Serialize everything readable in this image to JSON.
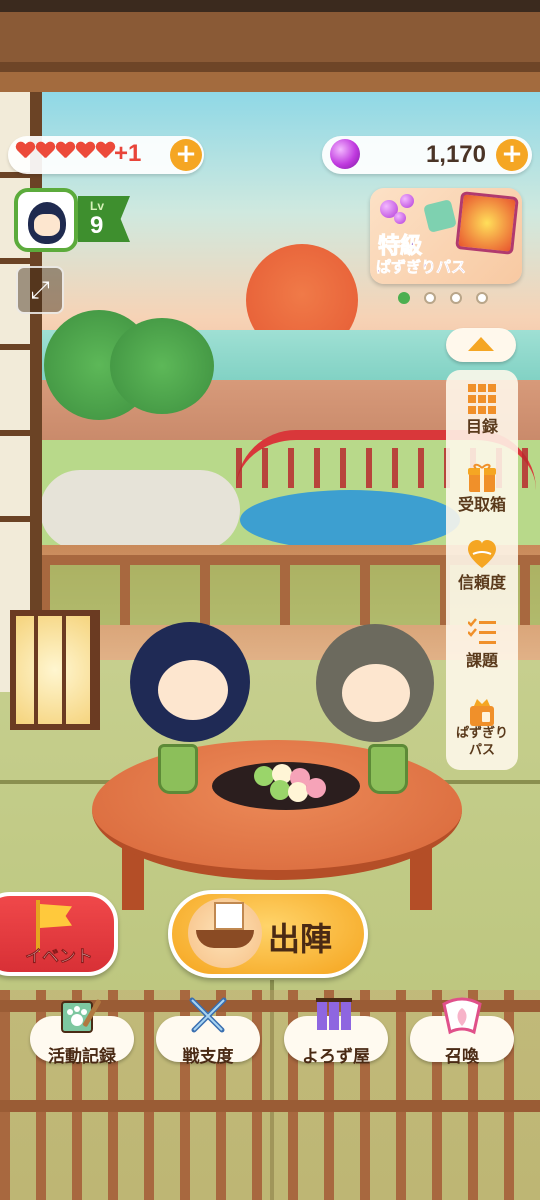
{
  "hud": {
    "hearts_count": 5,
    "hearts_bonus": "+1",
    "gems": "1,170",
    "level_label": "Lv",
    "level_value": "9"
  },
  "banner": {
    "line1": "特級",
    "line2": "ぱずぎりパス",
    "page_count": 4,
    "active_page": 1
  },
  "side_menu": {
    "items": [
      {
        "label": "目録",
        "icon": "grid-icon"
      },
      {
        "label": "受取箱",
        "icon": "gift-box-icon"
      },
      {
        "label": "信頼度",
        "icon": "heart-icon"
      },
      {
        "label": "課題",
        "icon": "checklist-icon"
      },
      {
        "label": "ぱずぎりパス",
        "line1": "ぱずぎり",
        "line2": "パス",
        "icon": "pass-bag-icon"
      }
    ]
  },
  "buttons": {
    "event": "イベント",
    "sortie": "出陣"
  },
  "bottom_nav": [
    {
      "label": "活動記録",
      "icon": "paw-scroll-icon"
    },
    {
      "label": "戦支度",
      "icon": "crossed-swords-icon"
    },
    {
      "label": "よろず屋",
      "icon": "shop-curtain-icon"
    },
    {
      "label": "召喚",
      "icon": "summon-fan-icon"
    }
  ],
  "colors": {
    "accent_orange": "#f5a623",
    "heart_red": "#ec4a3a",
    "level_green": "#3e8f2e",
    "event_red": "#e03a3e",
    "pass_purple": "#7b3fc7"
  }
}
